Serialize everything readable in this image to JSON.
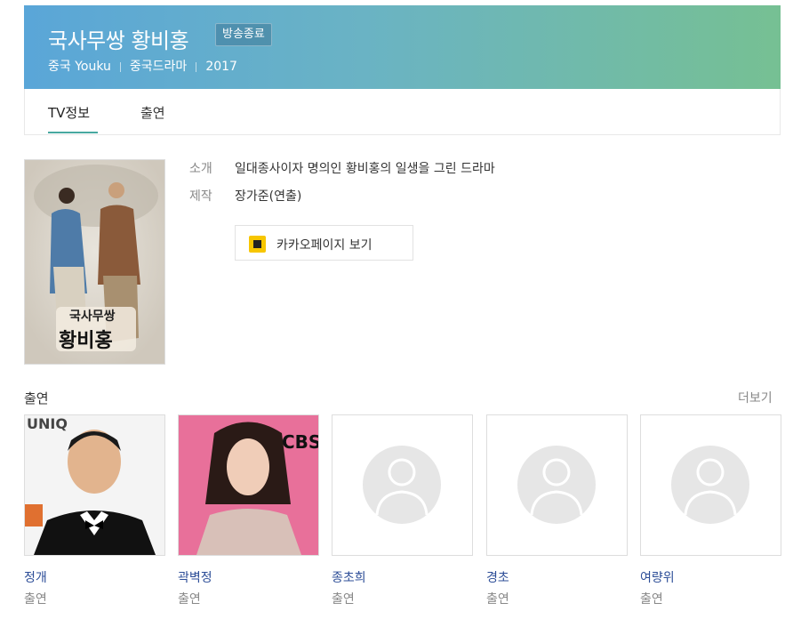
{
  "header": {
    "title": "국사무쌍 황비홍",
    "badge": "방송종료",
    "meta": [
      "중국 Youku",
      "중국드라마",
      "2017"
    ]
  },
  "tabs": [
    {
      "label": "TV정보"
    },
    {
      "label": "출연"
    }
  ],
  "info": {
    "intro_label": "소개",
    "intro_value": "일대종사이자 명의인 황비홍의 일생을 그린 드라마",
    "prod_label": "제작",
    "prod_value": "장가준(연출)",
    "kakao_button": "카카오페이지 보기"
  },
  "poster": {
    "text1": "국사무쌍",
    "text2": "황비홍"
  },
  "cast_section": {
    "title": "출연",
    "more": "더보기"
  },
  "cast": [
    {
      "name": "정개",
      "role": "출연"
    },
    {
      "name": "곽벽정",
      "role": "출연"
    },
    {
      "name": "종초희",
      "role": "출연"
    },
    {
      "name": "경초",
      "role": "출연"
    },
    {
      "name": "여량위",
      "role": "출연"
    }
  ],
  "colors": {
    "header_start": "#5aa6d8",
    "header_end": "#76c093",
    "link": "#2c4d97",
    "tab_accent": "#48a8a0",
    "kakao": "#f7c600"
  },
  "photo2_text": "CBS",
  "photo1_text": "UNIQ"
}
